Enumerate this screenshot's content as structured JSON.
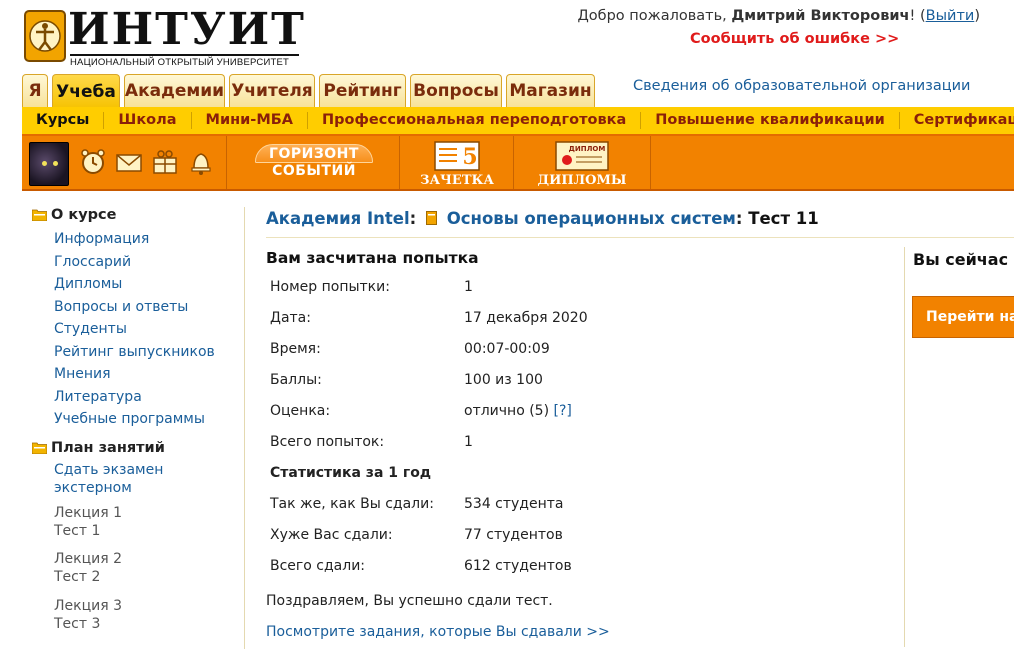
{
  "logo": {
    "word": "ИНТУИТ",
    "subtitle": "НАЦИОНАЛЬНЫЙ ОТКРЫТЫЙ УНИВЕРСИТЕТ"
  },
  "header": {
    "welcome_prefix": "Добро пожаловать,",
    "user_name": "Дмитрий Викторович",
    "exclaim": "!",
    "open_paren": "(",
    "logout": "Выйти",
    "close_paren": ")",
    "report_error": "Сообщить об ошибке >>"
  },
  "tabs": [
    {
      "label": "Я"
    },
    {
      "label": "Учеба",
      "active": true
    },
    {
      "label": "Академии"
    },
    {
      "label": "Учителя"
    },
    {
      "label": "Рейтинг"
    },
    {
      "label": "Вопросы"
    },
    {
      "label": "Магазин"
    }
  ],
  "org_info_link": "Сведения об образовательной организации",
  "subnav": [
    {
      "label": "Курсы",
      "active": true
    },
    {
      "label": "Школа"
    },
    {
      "label": "Мини-МБА"
    },
    {
      "label": "Профессиональная переподготовка"
    },
    {
      "label": "Повышение квалификации"
    },
    {
      "label": "Сертификации"
    }
  ],
  "toolbar": {
    "horizon_line1": "ГОРИЗОНТ",
    "horizon_line2": "СОБЫТИЙ",
    "gradebook": "ЗАЧЕТКА",
    "gradebook_mark": "5",
    "diplomas": "ДИПЛОМЫ",
    "diploma_badge": "ДИПЛОМ"
  },
  "sidebar": {
    "about_title": "О курсе",
    "about_links": [
      "Информация",
      "Глоссарий",
      "Дипломы",
      "Вопросы и ответы",
      "Студенты",
      "Рейтинг выпускников",
      "Мнения",
      "Литература",
      "Учебные программы"
    ],
    "plan_title": "План занятий",
    "exam_line1": "Сдать экзамен",
    "exam_line2": "экстерном",
    "lessons": [
      {
        "lecture": "Лекция 1",
        "test": "Тест 1"
      },
      {
        "lecture": "Лекция 2",
        "test": "Тест 2"
      },
      {
        "lecture": "Лекция 3",
        "test": "Тест 3"
      }
    ]
  },
  "breadcrumb": {
    "academy": "Академия Intel",
    "course": "Основы операционных систем",
    "current": "Тест 11",
    "separator": ":"
  },
  "result": {
    "title": "Вам засчитана попытка",
    "rows": [
      {
        "label": "Номер попытки:",
        "value": "1"
      },
      {
        "label": "Дата:",
        "value": "17 декабря 2020"
      },
      {
        "label": "Время:",
        "value": "00:07-00:09"
      },
      {
        "label": "Баллы:",
        "value": "100 из 100"
      },
      {
        "label": "Оценка:",
        "value": "отлично (5)",
        "hint": "[?]"
      },
      {
        "label": "Всего попыток:",
        "value": "1"
      }
    ],
    "stats_title": "Статистика за 1 год",
    "stats_rows": [
      {
        "label": "Так же, как Вы сдали:",
        "value": "534 студента"
      },
      {
        "label": "Хуже Вас сдали:",
        "value": "77 студентов"
      },
      {
        "label": "Всего сдали:",
        "value": "612 студентов"
      }
    ],
    "congrats": "Поздравляем, Вы успешно сдали тест.",
    "view_tasks": "Посмотрите задания, которые Вы сдавали >>"
  },
  "right_panel": {
    "title": "Вы сейчас",
    "button": "Перейти на"
  },
  "colors": {
    "orange": "#f28200",
    "yellow": "#ffcd00",
    "link": "#1a5e9a",
    "error_red": "#e01b1b"
  }
}
